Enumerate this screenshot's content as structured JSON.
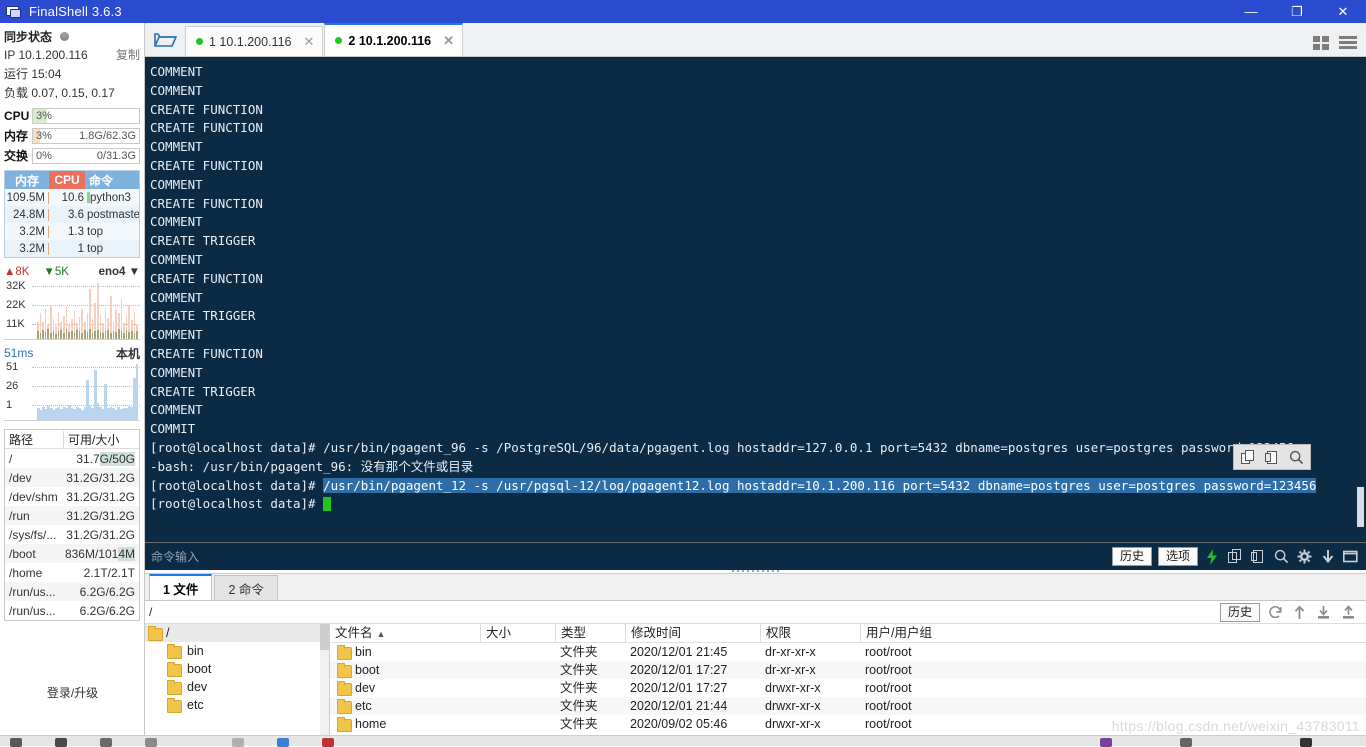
{
  "window": {
    "title": "FinalShell 3.6.3",
    "app_icon": "monitor-icon",
    "minimize": "—",
    "maximize": "❐",
    "close": "✕"
  },
  "sidebar": {
    "sync_label": "同步状态",
    "ip_label": "IP 10.1.200.116",
    "copy_label": "复制",
    "uptime_label": "运行 15:04",
    "load_label": "负载 0.07, 0.15, 0.17",
    "gauges": [
      {
        "name": "CPU",
        "pct": "3%",
        "detail": "",
        "fill_color": "#d8ecd0",
        "fill_pct": 13
      },
      {
        "name": "内存",
        "pct": "3%",
        "detail": "1.8G/62.3G",
        "fill_color": "#f7ddc2",
        "fill_pct": 7
      },
      {
        "name": "交换",
        "pct": "0%",
        "detail": "0/31.3G",
        "fill_color": "#ffffff",
        "fill_pct": 0
      }
    ],
    "proc_table": {
      "headers": [
        "内存",
        "CPU",
        "命令"
      ],
      "rows": [
        {
          "mem": "109.5M",
          "cpu": "10.6",
          "cmd": "python3"
        },
        {
          "mem": "24.8M",
          "cpu": "3.6",
          "cmd": "postmaster"
        },
        {
          "mem": "3.2M",
          "cpu": "1.3",
          "cmd": "top"
        },
        {
          "mem": "3.2M",
          "cpu": "1",
          "cmd": "top"
        }
      ]
    },
    "network": {
      "upload": "8K",
      "download": "5K",
      "interface": "eno4",
      "y_labels": [
        "32K",
        "22K",
        "11K"
      ],
      "up_values": [
        30,
        44,
        30,
        52,
        26,
        58,
        34,
        22,
        46,
        30,
        40,
        56,
        24,
        34,
        48,
        28,
        38,
        52,
        30,
        44,
        86,
        34,
        62,
        96,
        42,
        28,
        54,
        36,
        74,
        30,
        52,
        44,
        68,
        28,
        40,
        58,
        32,
        46,
        26
      ],
      "down_values": [
        14,
        10,
        16,
        12,
        18,
        11,
        14,
        9,
        13,
        15,
        10,
        17,
        12,
        14,
        11,
        16,
        13,
        10,
        15,
        12,
        18,
        11,
        14,
        16,
        12,
        10,
        13,
        15,
        11,
        14,
        12,
        17,
        13,
        10,
        16,
        12,
        14,
        11,
        13
      ]
    },
    "latency": {
      "current": "51ms",
      "host_label": "本机",
      "y_labels": [
        "51",
        "26",
        "1"
      ],
      "values": [
        20,
        18,
        22,
        19,
        24,
        20,
        18,
        21,
        23,
        19,
        22,
        20,
        26,
        21,
        19,
        23,
        20,
        18,
        22,
        68,
        24,
        20,
        86,
        30,
        22,
        19,
        62,
        21,
        23,
        20,
        18,
        22,
        19,
        21,
        20,
        24,
        22,
        72,
        96
      ]
    },
    "disk": {
      "headers": [
        "路径",
        "可用/大小"
      ],
      "rows": [
        {
          "path": "/",
          "size": "31.7G/50G",
          "highlight": "G/50G"
        },
        {
          "path": "/dev",
          "size": "31.2G/31.2G",
          "highlight": ""
        },
        {
          "path": "/dev/shm",
          "size": "31.2G/31.2G",
          "highlight": ""
        },
        {
          "path": "/run",
          "size": "31.2G/31.2G",
          "highlight": ""
        },
        {
          "path": "/sys/fs/...",
          "size": "31.2G/31.2G",
          "highlight": ""
        },
        {
          "path": "/boot",
          "size": "836M/1014M",
          "highlight": "4M"
        },
        {
          "path": "/home",
          "size": "2.1T/2.1T",
          "highlight": ""
        },
        {
          "path": "/run/us...",
          "size": "6.2G/6.2G",
          "highlight": ""
        },
        {
          "path": "/run/us...",
          "size": "6.2G/6.2G",
          "highlight": ""
        }
      ]
    },
    "login_upgrade": "登录/升级"
  },
  "tabbar": {
    "folder_icon": "open-folder-icon",
    "tabs": [
      {
        "index": "1",
        "label": "1 10.1.200.116",
        "active": false,
        "close": "✕"
      },
      {
        "index": "2",
        "label": "2 10.1.200.116",
        "active": true,
        "close": "✕"
      }
    ],
    "grid_view_icon": "grid-view-icon",
    "list_view_icon": "list-view-icon"
  },
  "terminal": {
    "output_lines": [
      "COMMENT",
      "COMMENT",
      "CREATE FUNCTION",
      "CREATE FUNCTION",
      "COMMENT",
      "CREATE FUNCTION",
      "COMMENT",
      "CREATE FUNCTION",
      "COMMENT",
      "CREATE TRIGGER",
      "COMMENT",
      "CREATE FUNCTION",
      "COMMENT",
      "CREATE TRIGGER",
      "COMMENT",
      "CREATE FUNCTION",
      "COMMENT",
      "CREATE TRIGGER",
      "COMMENT",
      "COMMIT"
    ],
    "prompt": "[root@localhost data]# ",
    "cmd1": "/usr/bin/pgagent_96 -s /PostgreSQL/96/data/pgagent.log hostaddr=127.0.0.1 port=5432 dbname=postgres user=postgres password=123456",
    "error_line": "-bash: /usr/bin/pgagent_96: 没有那个文件或目录",
    "cmd2_selected": "/usr/bin/pgagent_12 -s /usr/pgsql-12/log/pgagent12.log hostaddr=10.1.200.116 port=5432 dbname=postgres user=postgres password=123456",
    "float_tools": [
      "copy-icon",
      "paste-icon",
      "search-icon"
    ]
  },
  "cmdbar": {
    "placeholder": "命令输入",
    "history_button": "历史",
    "options_button": "选项",
    "icons": [
      "lightning-icon",
      "copy-icon",
      "paste-icon",
      "search-icon",
      "gear-icon",
      "download-icon",
      "window-icon"
    ]
  },
  "bottom": {
    "tabs": [
      {
        "label": "1 文件",
        "active": true
      },
      {
        "label": "2 命令",
        "active": false
      }
    ],
    "path_value": "/",
    "history_button": "历史",
    "toolbar_icons": [
      "refresh-icon",
      "up-level-icon",
      "download-icon",
      "upload-icon"
    ],
    "tree": {
      "root": "/",
      "children": [
        "bin",
        "boot",
        "dev",
        "etc"
      ]
    },
    "file_list": {
      "headers": [
        "文件名",
        "大小",
        "类型",
        "修改时间",
        "权限",
        "用户/用户组"
      ],
      "sort_caret": "▲",
      "rows": [
        {
          "name": "bin",
          "size": "",
          "type": "文件夹",
          "mtime": "2020/12/01 21:45",
          "perm": "dr-xr-xr-x",
          "owner": "root/root"
        },
        {
          "name": "boot",
          "size": "",
          "type": "文件夹",
          "mtime": "2020/12/01 17:27",
          "perm": "dr-xr-xr-x",
          "owner": "root/root"
        },
        {
          "name": "dev",
          "size": "",
          "type": "文件夹",
          "mtime": "2020/12/01 17:27",
          "perm": "drwxr-xr-x",
          "owner": "root/root"
        },
        {
          "name": "etc",
          "size": "",
          "type": "文件夹",
          "mtime": "2020/12/01 21:44",
          "perm": "drwxr-xr-x",
          "owner": "root/root"
        },
        {
          "name": "home",
          "size": "",
          "type": "文件夹",
          "mtime": "2020/09/02 05:46",
          "perm": "drwxr-xr-x",
          "owner": "root/root"
        }
      ]
    }
  },
  "watermark": "https://blog.csdn.net/weixin_43783011"
}
